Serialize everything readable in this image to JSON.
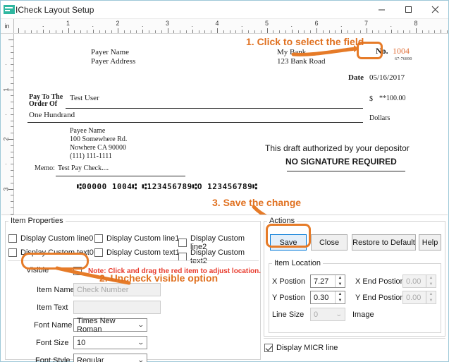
{
  "window": {
    "title": "ICheck Layout Setup",
    "icon": "app-icon",
    "minimize_label": "–",
    "maximize_label": "❐",
    "close_label": "✕",
    "accent_orange": "#e0701f",
    "highlight_orange": "#e67b28",
    "note_red": "#e83b2d",
    "focus_blue": "#0078d7"
  },
  "rulers": {
    "unit_label": "in",
    "horizontal_numbers": [
      "1",
      "2",
      "3",
      "4",
      "5",
      "6",
      "7",
      "8"
    ],
    "vertical_numbers": [
      "1",
      "2",
      "3"
    ],
    "dot_label": "·"
  },
  "check": {
    "payer_name": "Payer Name",
    "payer_address": "Payer Address",
    "bank_name": "My Bank",
    "bank_address": "123 Bank Road",
    "check_no_label": "No.",
    "check_no_value": "1004",
    "routing_fraction": "67-76890",
    "date_label": "Date",
    "date_value": "05/16/2017",
    "pay_to_line1": "Pay To The",
    "pay_to_line2": "Order Of",
    "payee_value": "Test User",
    "dollar_sign": "$",
    "amount_value": "**100.00",
    "amount_words": "One Hundrand",
    "dollars_label": "Dollars",
    "payee_addr_1": "Payee Name",
    "payee_addr_2": "100 Somewhere Rd.",
    "payee_addr_3": "Nowhere CA 90000",
    "payee_addr_4": "(111) 111-1111",
    "memo_label": "Memo:",
    "memo_value": "Test Pay Check....",
    "draft_line1": "This draft authorized by your depositor",
    "draft_line2": "NO SIGNATURE REQUIRED",
    "micr_line": "⑆00000 1004⑆ ⑆123456789⑆O 123456789⑆"
  },
  "annotations": {
    "step1": "1. Click to select the field",
    "step2": "2. Uncheck visible option",
    "step3": "3. Save the change"
  },
  "item_properties": {
    "legend": "Item Properties",
    "custom_checkboxes": [
      {
        "label": "Display Custom line0",
        "checked": false
      },
      {
        "label": "Display Custom line1",
        "checked": false
      },
      {
        "label": "Display Custom line2",
        "checked": false
      },
      {
        "label": "Display Custom text0",
        "checked": false
      },
      {
        "label": "Display Custom text1",
        "checked": false
      },
      {
        "label": "Display Custom text2",
        "checked": false
      }
    ],
    "visible_label": "Visible",
    "visible_checked": false,
    "note_text": "Note: Click and drag the red item to adjust location.",
    "item_name_label": "Item Name",
    "item_name_value": "Check Number",
    "item_text_label": "Item Text",
    "item_text_value": "",
    "font_name_label": "Font Name",
    "font_name_value": "Times New Roman",
    "font_size_label": "Font Size",
    "font_size_value": "10",
    "font_style_label": "Font Style",
    "font_style_value": "Regular",
    "caret": "⌄"
  },
  "actions": {
    "legend": "Actions",
    "save_label": "Save",
    "close_label": "Close",
    "restore_label": "Restore to Default",
    "help_label": "Help",
    "item_location_legend": "Item Location",
    "x_position_label": "X Postion",
    "x_position_value": "7.27",
    "y_position_label": "Y Postion",
    "y_position_value": "0.30",
    "x_end_label": "X End Postion",
    "x_end_value": "0.00",
    "y_end_label": "Y End Postion",
    "y_end_value": "0.00",
    "line_size_label": "Line Size",
    "line_size_value": "0",
    "image_label": "Image",
    "display_micr_label": "Display MICR line",
    "display_micr_checked": true,
    "spin_up": "▲",
    "spin_down": "▼",
    "caret": "⌄"
  }
}
